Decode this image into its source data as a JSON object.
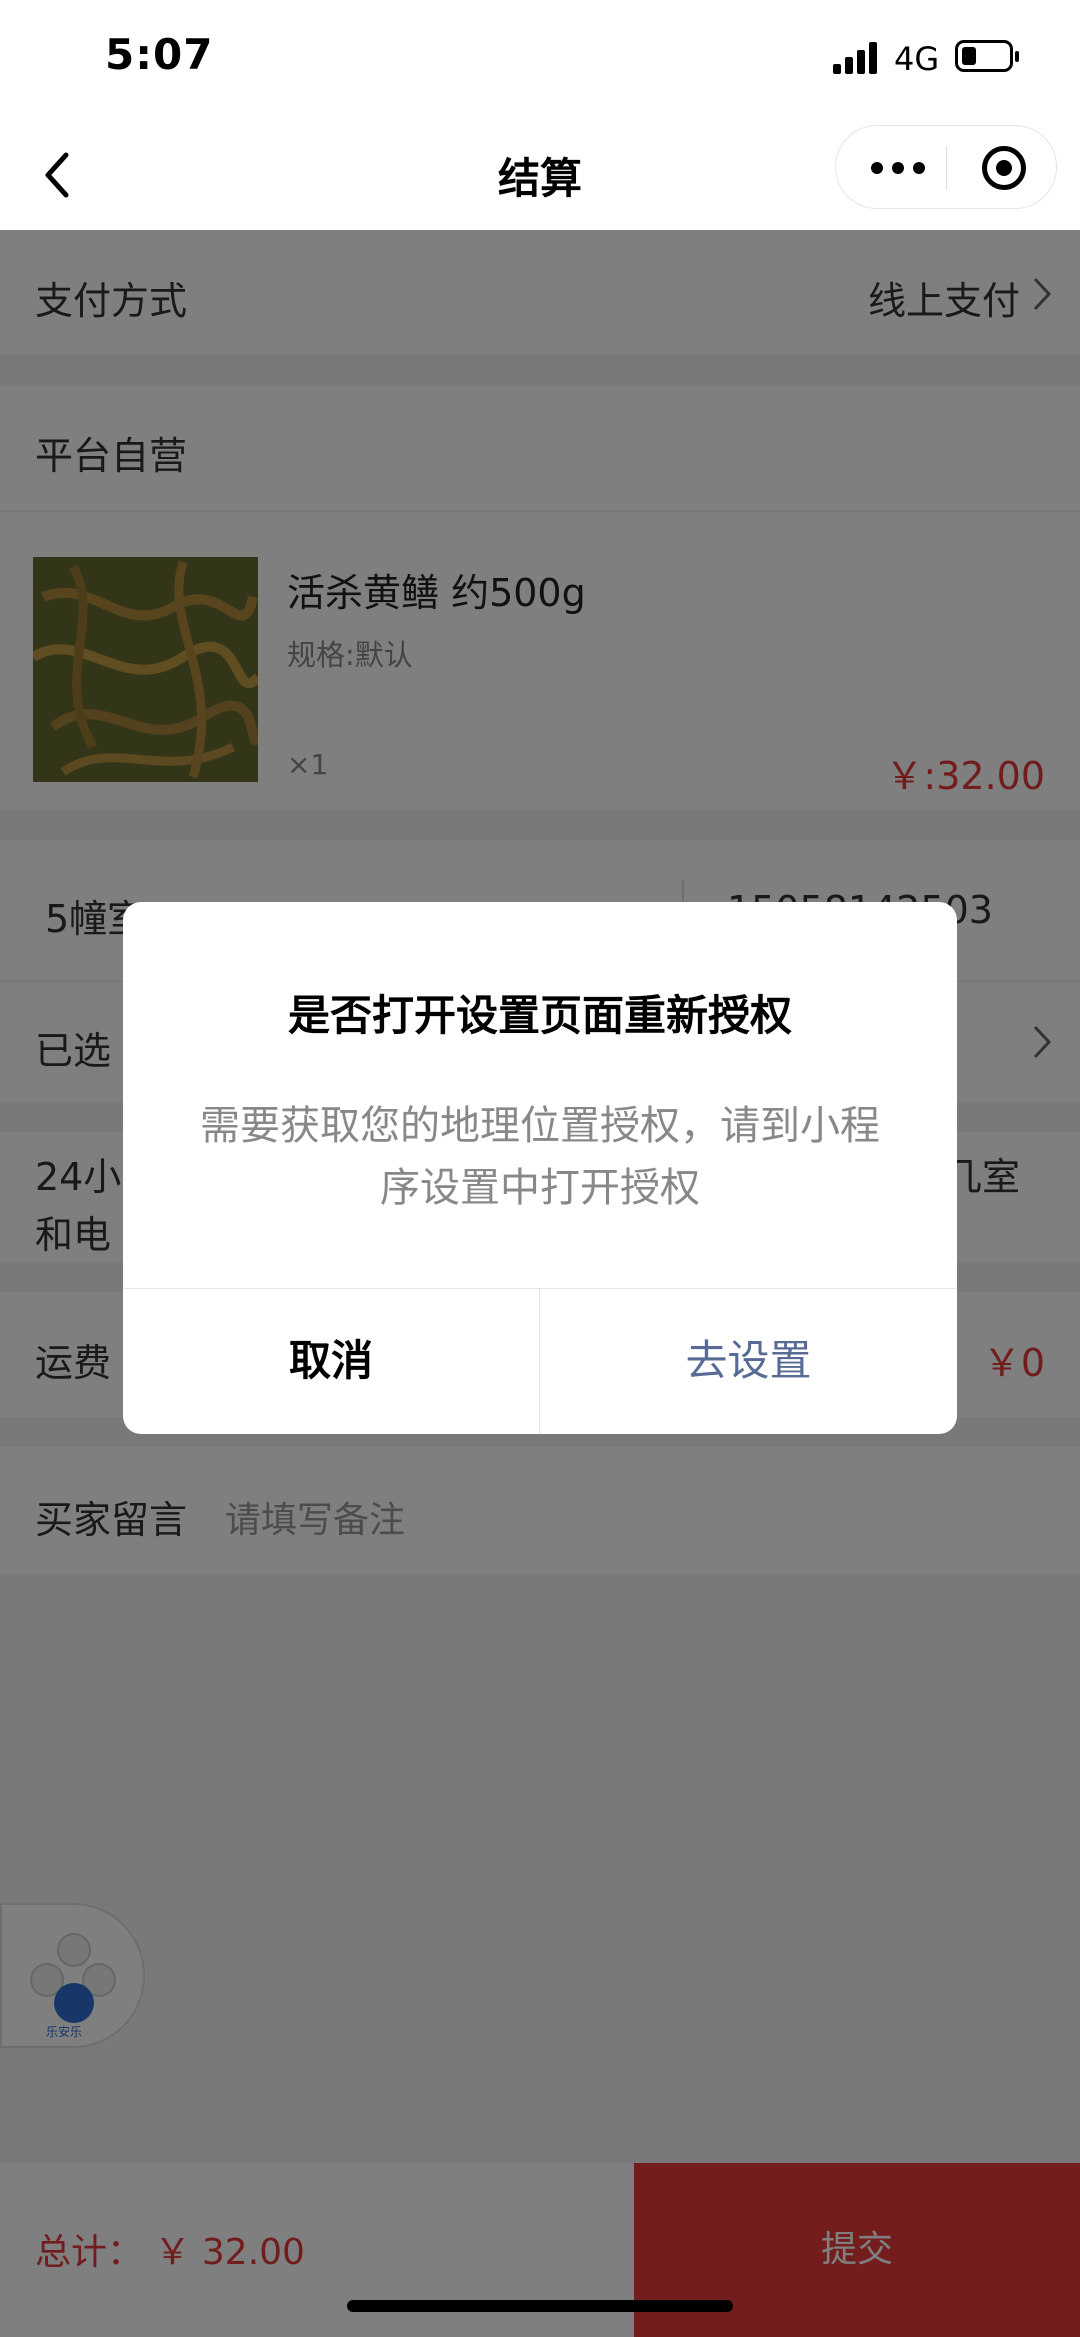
{
  "status_bar": {
    "time": "5:07",
    "network": "4G"
  },
  "nav": {
    "title": "结算"
  },
  "payment": {
    "label": "支付方式",
    "value": "线上支付"
  },
  "store": {
    "name": "平台自营"
  },
  "product": {
    "name": "活杀黄鳝 约500g",
    "spec": "规格:默认",
    "qty": "×1",
    "price": "￥:32.00"
  },
  "address": {
    "name_partial": "5幢室",
    "phone_partial": "15058142503"
  },
  "selected_row": {
    "label_partial": "已选"
  },
  "delivery": {
    "line1_partial": "24小",
    "line1_end": "几室",
    "line2_partial": "和电"
  },
  "shipping": {
    "label": "运费",
    "value": "￥0"
  },
  "message": {
    "label": "买家留言",
    "placeholder": "请填写备注"
  },
  "footer": {
    "total": "总计： ￥ 32.00",
    "submit": "提交"
  },
  "widget": {
    "logo_text": "乐安乐"
  },
  "dialog": {
    "title": "是否打开设置页面重新授权",
    "message": "需要获取您的地理位置授权，请到小程序设置中打开授权",
    "cancel": "取消",
    "confirm": "去设置",
    "confirm_color": "#576b95"
  },
  "colors": {
    "price_red": "#e23b3b",
    "submit_bg": "#e83b3b"
  }
}
